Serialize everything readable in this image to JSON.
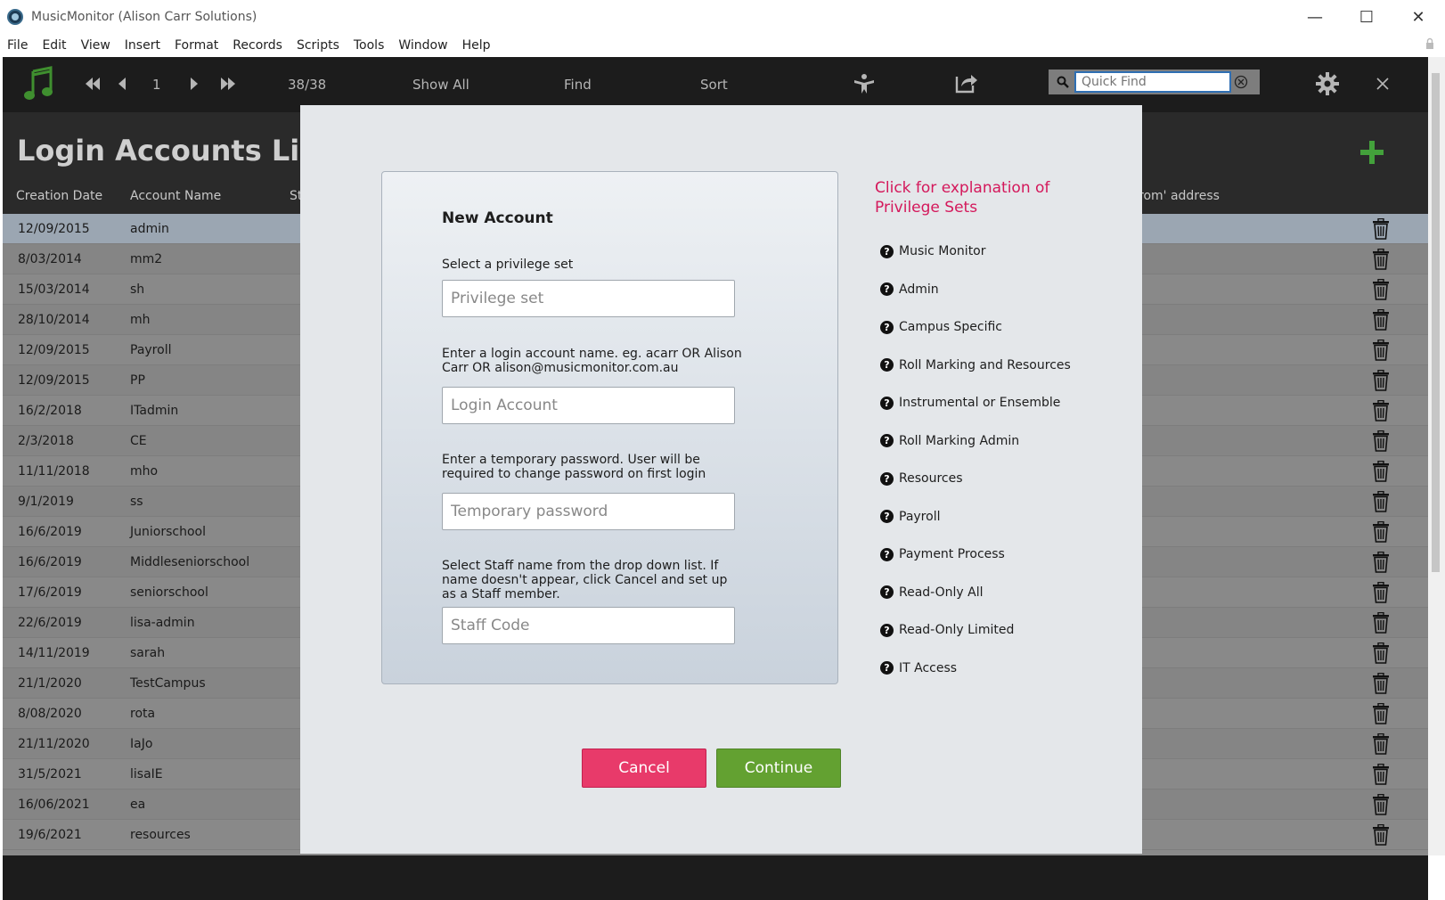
{
  "window": {
    "title": "MusicMonitor (Alison Carr Solutions)",
    "minimize": "—",
    "maximize": "☐",
    "close": "✕"
  },
  "menu": [
    "File",
    "Edit",
    "View",
    "Insert",
    "Format",
    "Records",
    "Scripts",
    "Tools",
    "Window",
    "Help"
  ],
  "toolbar": {
    "record_number": "1",
    "record_count": "38/38",
    "show_all": "Show All",
    "find": "Find",
    "sort": "Sort",
    "quick_find_placeholder": "Quick Find"
  },
  "layout": {
    "title": "Login Accounts List",
    "columns": {
      "creation_date": "Creation Date",
      "account_name": "Account Name",
      "col3_partial": "St",
      "from_address_partial": "rom' address"
    },
    "rows": [
      {
        "date": "12/09/2015",
        "name": "admin"
      },
      {
        "date": "8/03/2014",
        "name": "mm2"
      },
      {
        "date": "15/03/2014",
        "name": "sh"
      },
      {
        "date": "28/10/2014",
        "name": "mh"
      },
      {
        "date": "12/09/2015",
        "name": "Payroll"
      },
      {
        "date": "12/09/2015",
        "name": "PP"
      },
      {
        "date": "16/2/2018",
        "name": "ITadmin"
      },
      {
        "date": "2/3/2018",
        "name": "CE"
      },
      {
        "date": "11/11/2018",
        "name": "mho"
      },
      {
        "date": "9/1/2019",
        "name": "ss"
      },
      {
        "date": "16/6/2019",
        "name": "Juniorschool"
      },
      {
        "date": "16/6/2019",
        "name": "Middleseniorschool"
      },
      {
        "date": "17/6/2019",
        "name": "seniorschool"
      },
      {
        "date": "22/6/2019",
        "name": "lisa-admin"
      },
      {
        "date": "14/11/2019",
        "name": "sarah"
      },
      {
        "date": "21/1/2020",
        "name": "TestCampus"
      },
      {
        "date": "8/08/2020",
        "name": "rota"
      },
      {
        "date": "21/11/2020",
        "name": "IaJo"
      },
      {
        "date": "31/5/2021",
        "name": "lisaIE"
      },
      {
        "date": "16/06/2021",
        "name": "ea"
      },
      {
        "date": "19/6/2021",
        "name": "resources"
      }
    ]
  },
  "dialog": {
    "title": "New Account",
    "privilege_label": "Select a privilege set",
    "privilege_placeholder": "Privilege set",
    "login_label": "Enter a login account name.  eg. acarr OR Alison Carr OR alison@musicmonitor.com.au",
    "login_placeholder": "Login Account",
    "password_label": "Enter a temporary password. User will be required to change password on first login",
    "password_placeholder": "Temporary password",
    "staff_label": "Select Staff name from the drop down list. If name doesn't appear, click Cancel and set up as a Staff member.",
    "staff_placeholder": "Staff Code",
    "explanation_heading": "Click for explanation of Privilege Sets",
    "privilege_sets": [
      "Music Monitor",
      "Admin",
      "Campus Specific",
      "Roll Marking and Resources",
      "Instrumental or Ensemble",
      "Roll Marking Admin",
      "Resources",
      "Payroll",
      "Payment Process",
      "Read-Only All",
      "Read-Only Limited",
      "IT Access"
    ],
    "cancel_label": "Cancel",
    "continue_label": "Continue"
  },
  "colors": {
    "accent_pink": "#d4185b",
    "cancel": "#e83a6a",
    "continue": "#63a131",
    "add": "#43a13b",
    "music_icon": "#3f8f2f"
  }
}
